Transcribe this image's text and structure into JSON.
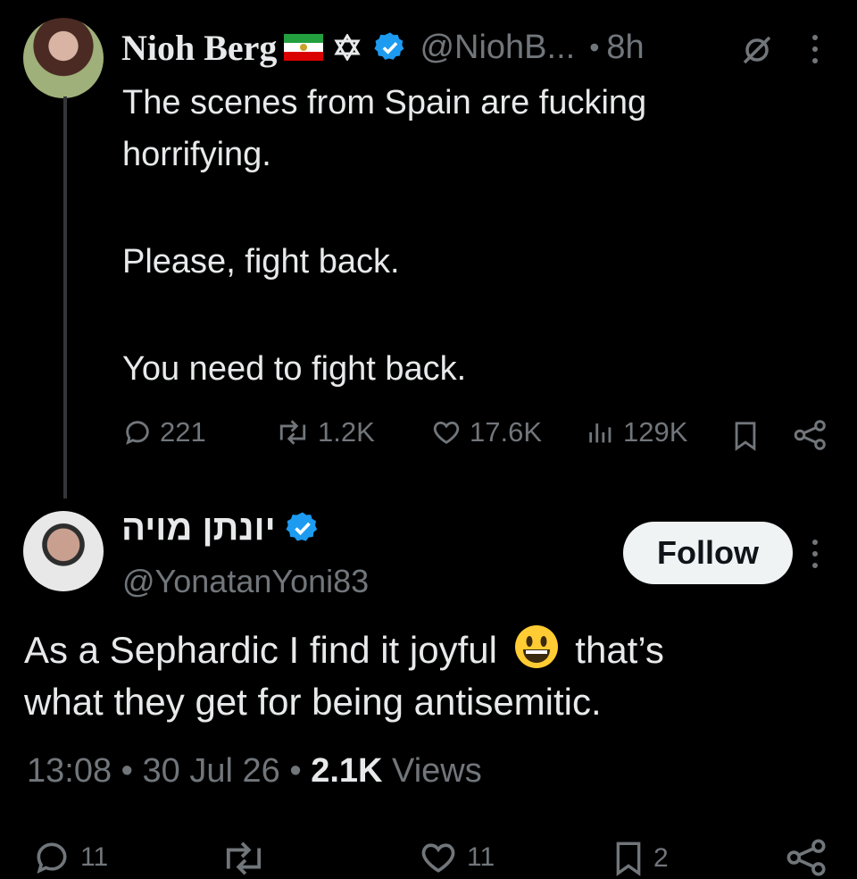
{
  "parent_tweet": {
    "display_name": "Nioh Berg",
    "badges": [
      "iran-lion-sun-flag-icon",
      "star-of-david-icon",
      "verified-badge-icon"
    ],
    "handle": "@NiohB...",
    "separator": "•",
    "time": "8h",
    "text_lines": [
      "The scenes from Spain are fucking",
      "horrifying."
    ],
    "para2": "Please, fight back.",
    "para3": "You need to fight back.",
    "stats": {
      "replies": "221",
      "reposts": "1.2K",
      "likes": "17.6K",
      "views": "129K"
    }
  },
  "reply_tweet": {
    "display_name": "יונתן מויה",
    "handle": "@YonatanYoni83",
    "follow_label": "Follow",
    "text_line1_a": "As a Sephardic I find it joyful",
    "text_line1_b": "that’s",
    "emoji": "😃",
    "text_line2": "what they get for being antisemitic.",
    "time": "13:08",
    "date": "30 Jul 26",
    "dot": "•",
    "views_count": "2.1K",
    "views_label": "Views",
    "actions": {
      "replies": "11",
      "likes": "11",
      "bookmarks": "2"
    }
  },
  "colors": {
    "background": "#000000",
    "text": "#e7e9ea",
    "muted": "#71767b",
    "verified": "#1d9bf0",
    "follow_bg": "#eff3f4"
  }
}
